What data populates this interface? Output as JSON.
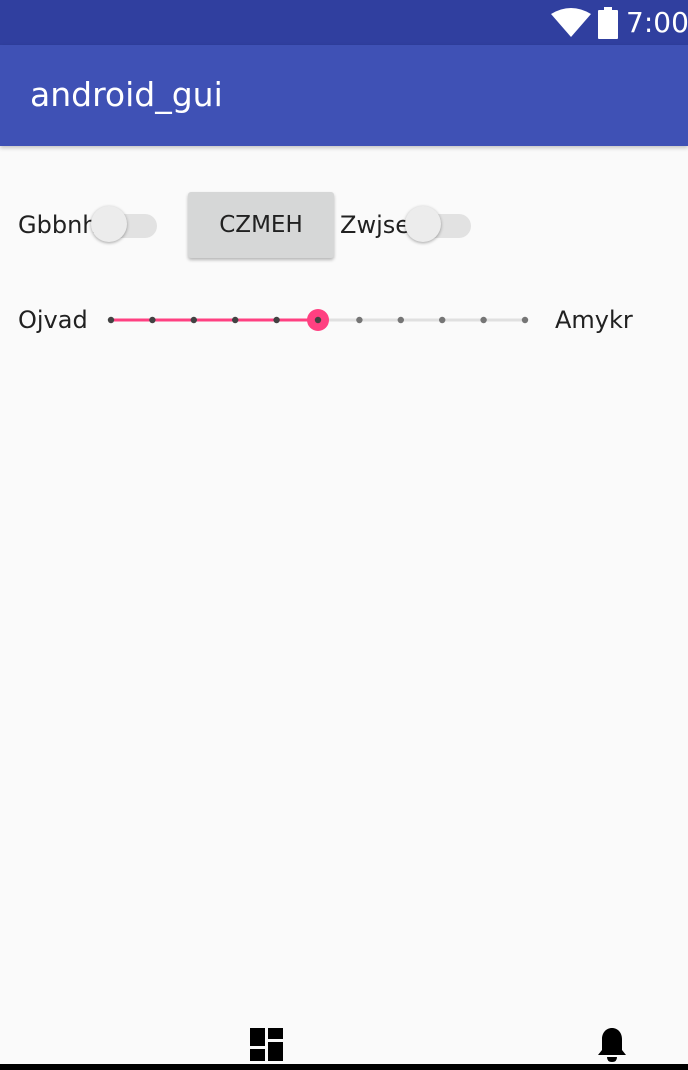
{
  "status_bar": {
    "time": "7:00",
    "icons": [
      "wifi-icon",
      "battery-icon"
    ],
    "background": "#303f9f"
  },
  "app_bar": {
    "title": "android_gui",
    "background": "#3f51b5"
  },
  "controls": {
    "switch1": {
      "label": "Gbbnh",
      "checked": false
    },
    "button": {
      "label": "CZMEH"
    },
    "switch2": {
      "label": "Zwjse",
      "checked": false
    }
  },
  "seekbar": {
    "left_label": "Ojvad",
    "right_label": "Amykr",
    "max": 10,
    "value": 5,
    "accent": "#ff4081"
  },
  "bottom_nav": {
    "icons": [
      "dashboard-icon",
      "bell-icon"
    ]
  }
}
